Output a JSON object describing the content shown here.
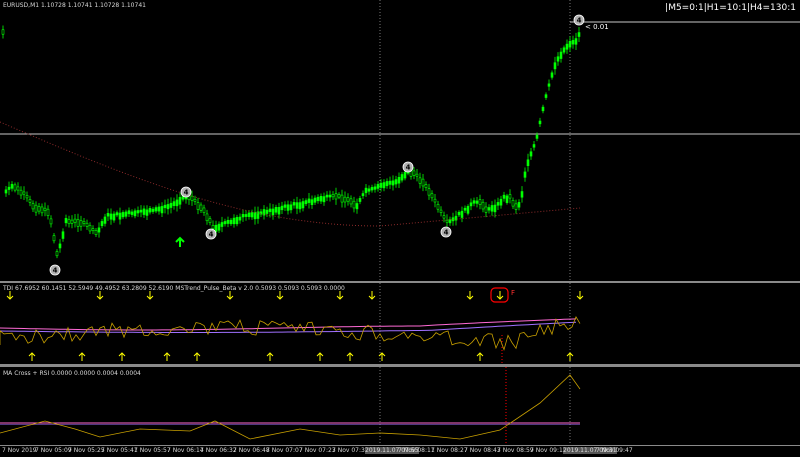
{
  "main": {
    "symbol_info": "EURUSD,M1  1.10728 1.10741 1.10728 1.10741",
    "tf_status": "|M5=0:1|H1=10:1|H4=130:1",
    "annotation": "< 0.01",
    "swing_label": "4",
    "colors": {
      "bull": "#00ff00",
      "bear": "#00ff00",
      "ma": "#8b2a2a",
      "hline": "#c8c8c8",
      "arrow_up": "#00ff00"
    }
  },
  "indicator1": {
    "header": "TDI 67.6952 60.1451 52.5949 49.4952 63.2809 52.6190  MSTrend_Pulse_Beta v 2.0 0.5093 0.5093 0.5093 0.0000",
    "signal_label": "F",
    "colors": {
      "price_line": "#c8a000",
      "signal_line": "#ff6ad5",
      "base_line": "#a070ff",
      "arrow": "#ffff00",
      "marker": "#ff0000"
    }
  },
  "indicator2": {
    "header": "MA Cross + RSI 0.0000 0.0000 0.0004 0.0004",
    "colors": {
      "rsi_line": "#c8a000",
      "level_line": "#ff6ad5",
      "level_line2": "#a070ff"
    }
  },
  "time_axis": {
    "labels": [
      "7 Nov 2019",
      "7 Nov 05:09",
      "7 Nov 05:25",
      "7 Nov 05:41",
      "7 Nov 05:57",
      "7 Nov 06:14",
      "7 Nov 06:32",
      "7 Nov 06:48",
      "7 Nov 07:07",
      "7 Nov 07:23",
      "7 Nov 07:39",
      "2019.11.07 07:55",
      "7 Nov 08:11",
      "7 Nov 08:27",
      "7 Nov 08:43",
      "7 Nov 08:59",
      "7 Nov 09:15",
      "2019.11.07 09:31",
      "7 Nov 09:47"
    ]
  }
}
